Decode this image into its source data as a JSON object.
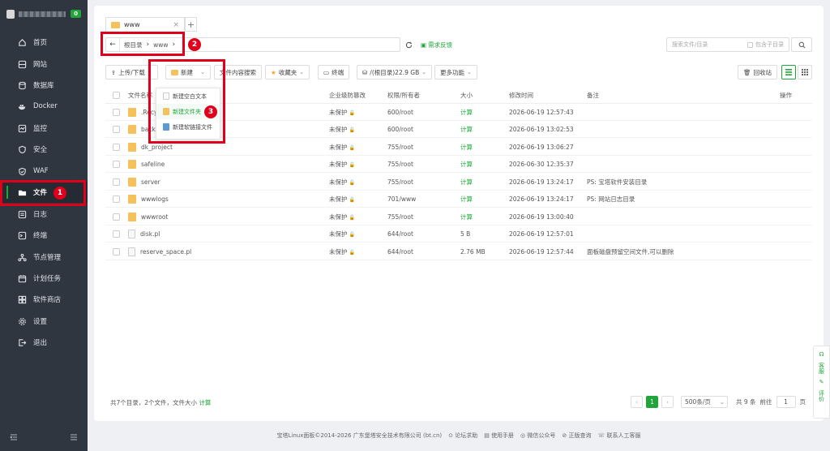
{
  "sidebar": {
    "badge": "0",
    "items": [
      {
        "label": "首页",
        "icon": "home-icon"
      },
      {
        "label": "网站",
        "icon": "globe-icon"
      },
      {
        "label": "数据库",
        "icon": "database-icon"
      },
      {
        "label": "Docker",
        "icon": "docker-icon"
      },
      {
        "label": "监控",
        "icon": "monitor-icon"
      },
      {
        "label": "安全",
        "icon": "shield-icon"
      },
      {
        "label": "WAF",
        "icon": "waf-icon"
      },
      {
        "label": "文件",
        "icon": "folder-icon"
      },
      {
        "label": "日志",
        "icon": "log-icon"
      },
      {
        "label": "终端",
        "icon": "terminal-icon"
      },
      {
        "label": "节点管理",
        "icon": "node-icon"
      },
      {
        "label": "计划任务",
        "icon": "calendar-icon"
      },
      {
        "label": "软件商店",
        "icon": "store-icon"
      },
      {
        "label": "设置",
        "icon": "gear-icon"
      },
      {
        "label": "退出",
        "icon": "logout-icon"
      }
    ]
  },
  "annotations": {
    "n1": "1",
    "n2": "2",
    "n3": "3"
  },
  "tab": {
    "label": "www",
    "close": "×",
    "add": "+"
  },
  "address": {
    "root": "根目录",
    "current": "www"
  },
  "feedback": "需求反馈",
  "search": {
    "placeholder": "搜索文件/目录",
    "sub_label": "包含子目录"
  },
  "toolbar": {
    "upload": "上传/下载",
    "new": "新建",
    "content_search": "文件内容搜索",
    "favorites": "收藏夹",
    "terminal": "终端",
    "disk": "/(根目录)22.9 GB",
    "more": "更多功能",
    "recycle": "回收站"
  },
  "dropdown": {
    "items": [
      "新建空白文本",
      "新建文件夹",
      "新建软链接文件"
    ]
  },
  "table": {
    "headers": {
      "name": "文件名称",
      "protect": "企业级防篡改",
      "perm": "权限/所有者",
      "size": "大小",
      "mtime": "修改时间",
      "note": "备注",
      "op": "操作"
    },
    "rows": [
      {
        "name": ".Recy",
        "type": "folder",
        "protect": "未保护",
        "perm": "600/root",
        "size": "计算",
        "mtime": "2026-06-19 12:57:43",
        "note": ""
      },
      {
        "name": "back",
        "type": "folder",
        "protect": "未保护",
        "perm": "600/root",
        "size": "计算",
        "mtime": "2026-06-19 13:02:53",
        "note": ""
      },
      {
        "name": "dk_project",
        "type": "folder",
        "protect": "未保护",
        "perm": "755/root",
        "size": "计算",
        "mtime": "2026-06-19 13:06:27",
        "note": ""
      },
      {
        "name": "safeline",
        "type": "folder",
        "protect": "未保护",
        "perm": "755/root",
        "size": "计算",
        "mtime": "2026-06-30 12:35:37",
        "note": ""
      },
      {
        "name": "server",
        "type": "folder",
        "protect": "未保护",
        "perm": "755/root",
        "size": "计算",
        "mtime": "2026-06-19 13:24:17",
        "note": "PS: 宝塔软件安装目录"
      },
      {
        "name": "wwwlogs",
        "type": "folder",
        "protect": "未保护",
        "perm": "701/www",
        "size": "计算",
        "mtime": "2026-06-19 13:24:17",
        "note": "PS: 网站日志目录"
      },
      {
        "name": "wwwroot",
        "type": "folder",
        "protect": "未保护",
        "perm": "755/root",
        "size": "计算",
        "mtime": "2026-06-19 13:00:40",
        "note": ""
      },
      {
        "name": "disk.pl",
        "type": "file",
        "protect": "未保护",
        "perm": "644/root",
        "size": "5 B",
        "mtime": "2026-06-19 12:57:01",
        "note": ""
      },
      {
        "name": "reserve_space.pl",
        "type": "file",
        "protect": "未保护",
        "perm": "644/root",
        "size": "2.76 MB",
        "mtime": "2026-06-19 12:57:44",
        "note": "面板磁盘预留空间文件,可以删除"
      }
    ]
  },
  "summary": {
    "text": "共7个目录，2个文件，文件大小",
    "calc": "计算"
  },
  "pager": {
    "current": "1",
    "per_page": "500条/页",
    "total": "共 9 条",
    "goto": "前往",
    "page_input": "1",
    "page_unit": "页"
  },
  "footer": {
    "copyright": "宝塔Linux面板©2014-2026 广东堡塔安全技术有限公司 (bt.cn)",
    "links": [
      "论坛求助",
      "使用手册",
      "微信公众号",
      "正版查询",
      "联系人工客服"
    ]
  },
  "widget": {
    "service": "客服",
    "review": "评价"
  },
  "colors": {
    "accent": "#20a53a",
    "sidebar": "#2f3640",
    "highlight": "#e0001b"
  }
}
